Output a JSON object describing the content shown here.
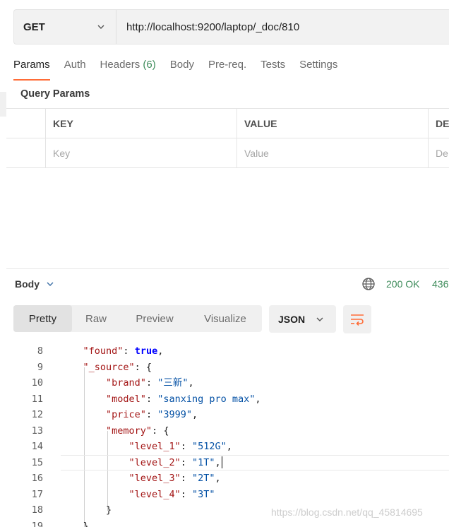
{
  "request": {
    "method": "GET",
    "url": "http://localhost:9200/laptop/_doc/810"
  },
  "tabs": [
    {
      "label": "Params",
      "active": true
    },
    {
      "label": "Auth"
    },
    {
      "label": "Headers ",
      "count": "(6)"
    },
    {
      "label": "Body"
    },
    {
      "label": "Pre-req."
    },
    {
      "label": "Tests"
    },
    {
      "label": "Settings"
    }
  ],
  "query_params": {
    "title": "Query Params",
    "headers": [
      "KEY",
      "VALUE",
      "DE"
    ],
    "placeholders": [
      "Key",
      "Value",
      "De"
    ]
  },
  "response": {
    "body_label": "Body",
    "status": "200 OK",
    "size": "436",
    "views": [
      "Pretty",
      "Raw",
      "Preview",
      "Visualize"
    ],
    "active_view": "Pretty",
    "format": "JSON"
  },
  "code_lines": [
    {
      "n": "8",
      "parts": [
        [
          "p",
          "    "
        ],
        [
          "k",
          "\"found\""
        ],
        [
          "p",
          ": "
        ],
        [
          "b",
          "true"
        ],
        [
          "p",
          ","
        ]
      ]
    },
    {
      "n": "9",
      "parts": [
        [
          "p",
          "    "
        ],
        [
          "k",
          "\"_source\""
        ],
        [
          "p",
          ": {"
        ]
      ]
    },
    {
      "n": "10",
      "parts": [
        [
          "p",
          "        "
        ],
        [
          "k",
          "\"brand\""
        ],
        [
          "p",
          ": "
        ],
        [
          "s",
          "\"三新\""
        ],
        [
          "p",
          ","
        ]
      ]
    },
    {
      "n": "11",
      "parts": [
        [
          "p",
          "        "
        ],
        [
          "k",
          "\"model\""
        ],
        [
          "p",
          ": "
        ],
        [
          "s",
          "\"sanxing pro max\""
        ],
        [
          "p",
          ","
        ]
      ]
    },
    {
      "n": "12",
      "parts": [
        [
          "p",
          "        "
        ],
        [
          "k",
          "\"price\""
        ],
        [
          "p",
          ": "
        ],
        [
          "s",
          "\"3999\""
        ],
        [
          "p",
          ","
        ]
      ]
    },
    {
      "n": "13",
      "parts": [
        [
          "p",
          "        "
        ],
        [
          "k",
          "\"memory\""
        ],
        [
          "p",
          ": {"
        ]
      ]
    },
    {
      "n": "14",
      "parts": [
        [
          "p",
          "            "
        ],
        [
          "k",
          "\"level_1\""
        ],
        [
          "p",
          ": "
        ],
        [
          "s",
          "\"512G\""
        ],
        [
          "p",
          ","
        ]
      ]
    },
    {
      "n": "15",
      "parts": [
        [
          "p",
          "            "
        ],
        [
          "k",
          "\"level_2\""
        ],
        [
          "p",
          ": "
        ],
        [
          "s",
          "\"1T\""
        ],
        [
          "p",
          ","
        ]
      ],
      "cursor": true
    },
    {
      "n": "16",
      "parts": [
        [
          "p",
          "            "
        ],
        [
          "k",
          "\"level_3\""
        ],
        [
          "p",
          ": "
        ],
        [
          "s",
          "\"2T\""
        ],
        [
          "p",
          ","
        ]
      ]
    },
    {
      "n": "17",
      "parts": [
        [
          "p",
          "            "
        ],
        [
          "k",
          "\"level_4\""
        ],
        [
          "p",
          ": "
        ],
        [
          "s",
          "\"3T\""
        ]
      ]
    },
    {
      "n": "18",
      "parts": [
        [
          "p",
          "        }"
        ]
      ]
    },
    {
      "n": "19",
      "parts": [
        [
          "p",
          "    }"
        ]
      ]
    }
  ],
  "watermark": "https://blog.csdn.net/qq_45814695"
}
